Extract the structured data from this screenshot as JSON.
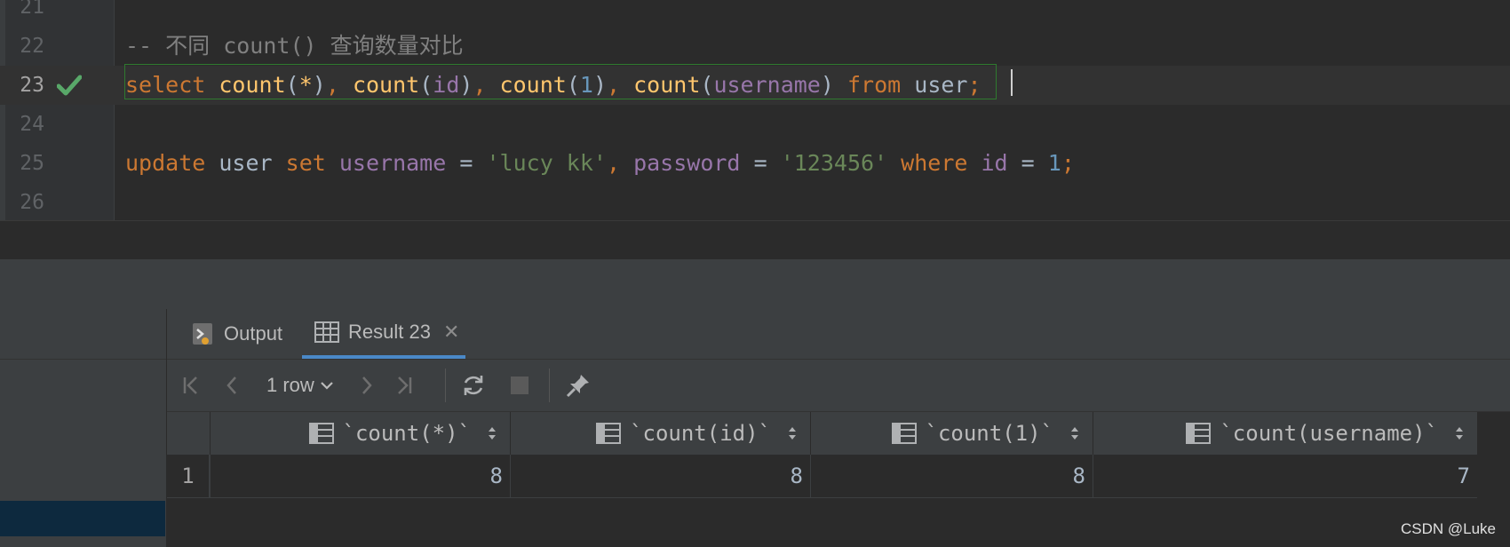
{
  "editor": {
    "lines": [
      {
        "num": "21"
      },
      {
        "num": "22",
        "comment": "-- 不同 count() 查询数量对比"
      },
      {
        "num": "23"
      },
      {
        "num": "24"
      },
      {
        "num": "25"
      },
      {
        "num": "26"
      }
    ],
    "line23_tokens": {
      "select": "select",
      "count1": "count",
      "p1": "(",
      "star": "*",
      "p2": ")",
      "c1": ", ",
      "count2": "count",
      "p3": "(",
      "id": "id",
      "p4": ")",
      "c2": ", ",
      "count3": "count",
      "p5": "(",
      "one": "1",
      "p6": ")",
      "c3": ", ",
      "count4": "count",
      "p7": "(",
      "username": "username",
      "p8": ")",
      "from": "from",
      "table": "user",
      "semi": ";"
    },
    "line25_tokens": {
      "update": "update",
      "table": "user",
      "set": "set",
      "username": "username",
      "eq1": "=",
      "val1": "'lucy kk'",
      "comma": ",",
      "password": "password",
      "eq2": "=",
      "val2": "'123456'",
      "where": "where",
      "id": "id",
      "eq3": "=",
      "one": "1",
      "semi": ";"
    }
  },
  "panel": {
    "tabs": [
      {
        "label": "Output",
        "icon": "output-console-icon"
      },
      {
        "label": "Result 23",
        "icon": "table-grid-icon",
        "close": "✕"
      }
    ],
    "toolbar": {
      "rows_label": "1 row"
    },
    "grid": {
      "columns": [
        "`count(*)`",
        "`count(id)`",
        "`count(1)`",
        "`count(username)`"
      ],
      "rows": [
        {
          "num": "1",
          "values": [
            "8",
            "8",
            "8",
            "7"
          ]
        }
      ]
    }
  },
  "watermark": "CSDN @Luke",
  "colors": {
    "keyword": "#cc7832",
    "function": "#ffc66d",
    "column": "#9876aa",
    "number": "#6897bb",
    "string": "#6a8759",
    "comment": "#808080",
    "success": "#59a869",
    "accent": "#4a88c7"
  }
}
